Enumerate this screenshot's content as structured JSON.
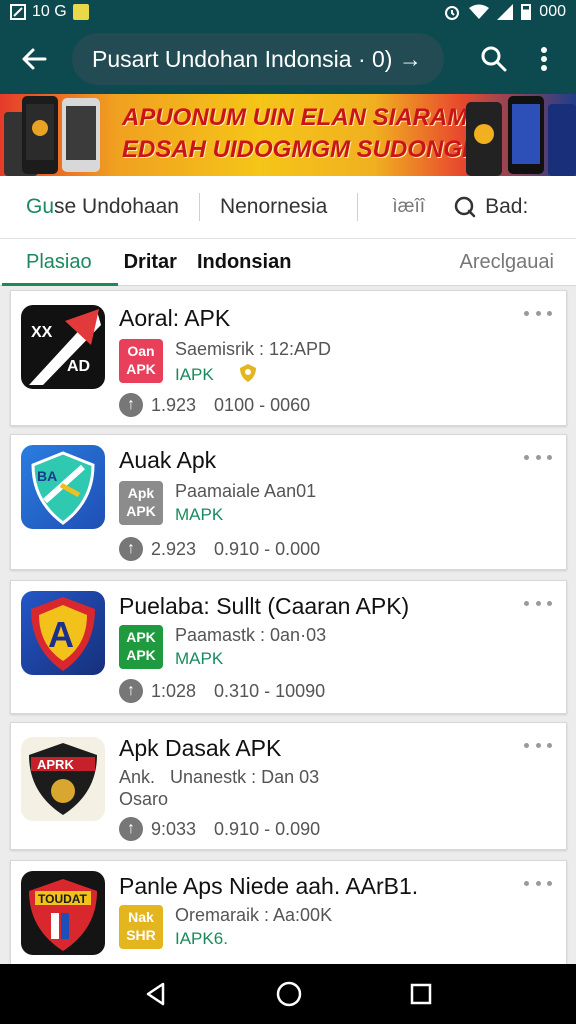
{
  "status_bar": {
    "time": "10 G",
    "battery": "000"
  },
  "search": {
    "query": "Pusart Undohan Indonsia · 0) →"
  },
  "banner": {
    "line1": "APUONUM UIN ELAN SIARAMI",
    "line2": "EDSAH UIDOGMGM SUDONGH!"
  },
  "filters": {
    "item1_prefix": "Gu",
    "item1_rest": "se Undohaan",
    "item2": "Nenornesia",
    "item3": "ìæîî",
    "item4": "Bad:"
  },
  "tabs": [
    {
      "label": "Plasiao"
    },
    {
      "label": "Dritar"
    },
    {
      "label": "Indonsian"
    },
    {
      "label": "Areclgauai"
    }
  ],
  "apps": [
    {
      "title": "Aoral: APK",
      "badge_top": "Oan",
      "badge_bottom": "APK",
      "badge_color": "#e8405a",
      "meta": "Saemisrik : 12:APD",
      "apk": "IAPK",
      "downloads": "1.923",
      "range": "0100 - 0060"
    },
    {
      "title": "Auak Apk",
      "badge_top": "Apk",
      "badge_bottom": "APK",
      "badge_color": "#8c8c8c",
      "meta": "Paamaiale Aan01",
      "apk": "MAPK",
      "downloads": "2.923",
      "range": "0.910 - 0.000"
    },
    {
      "title": "Puelaba: Sullt (Caaran APK)",
      "badge_top": "APK",
      "badge_bottom": "APK",
      "badge_color": "#1f9a3e",
      "meta": "Paamastk : 0an·03",
      "apk": "MAPK",
      "downloads": "1:028",
      "range": "0.310 - 10090"
    },
    {
      "title": "Apk Dasak APK",
      "badge_top": "Ank.",
      "badge_bottom": "Osaro",
      "badge_color": "",
      "meta": "Unanestk : Dan 03",
      "apk": "",
      "downloads": "9:033",
      "range": "0.910 - 0.090"
    },
    {
      "title": "Panle Aps Niede aah. AArB1.",
      "badge_top": "Nak",
      "badge_bottom": "SHR",
      "badge_color": "#e3b51e",
      "meta": "Oremaraik : Aa:00K",
      "apk": "IAPK6.",
      "downloads": "",
      "range": ""
    }
  ],
  "icons": {
    "back": "back-arrow-icon",
    "search": "search-icon",
    "menu": "more-vert-icon",
    "wifi": "wifi-icon",
    "signal": "signal-icon",
    "battery": "battery-icon",
    "alarm": "alarm-icon"
  },
  "colors": {
    "header": "#0d4a4f",
    "accent_green": "#1a8a5e"
  }
}
